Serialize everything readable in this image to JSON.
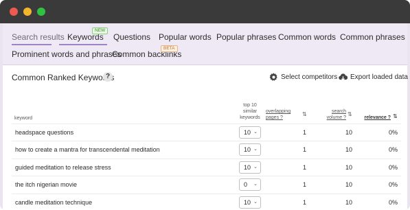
{
  "tabs": {
    "row1": [
      {
        "label": "Search results",
        "active": true
      },
      {
        "label": "Keywords",
        "badge": "NEW"
      },
      {
        "label": "Questions"
      },
      {
        "label": "Popular words"
      },
      {
        "label": "Popular phrases"
      },
      {
        "label": "Common words"
      },
      {
        "label": "Common phrases"
      }
    ],
    "row2": [
      {
        "label": "Prominent words and phrases"
      },
      {
        "label": "Common backlinks",
        "badge": "BETA"
      }
    ]
  },
  "panel": {
    "title": "Common Ranked Keywords",
    "help": "?",
    "select_competitors": "Select competitors",
    "export": "Export loaded data"
  },
  "table": {
    "headers": {
      "keyword": "keyword",
      "top10_line1": "top 10",
      "top10_line2": "similar",
      "top10_line3": "keywords",
      "overlap_line1": "overlapping",
      "overlap_line2": "pages ?",
      "volume_line1": "search",
      "volume_line2": "volume ?",
      "relevance": "relevance ?"
    },
    "rows": [
      {
        "keyword": "headspace questions",
        "top10": "10",
        "overlap": "1",
        "volume": "10",
        "relevance": "0%"
      },
      {
        "keyword": "how to create a mantra for transcendental meditation",
        "top10": "10",
        "overlap": "1",
        "volume": "10",
        "relevance": "0%"
      },
      {
        "keyword": "guided meditation to release stress",
        "top10": "10",
        "overlap": "1",
        "volume": "10",
        "relevance": "0%"
      },
      {
        "keyword": "the itch nigerian movie",
        "top10": "0",
        "overlap": "1",
        "volume": "10",
        "relevance": "0%"
      },
      {
        "keyword": "candle meditation technique",
        "top10": "10",
        "overlap": "1",
        "volume": "10",
        "relevance": "0%"
      }
    ]
  },
  "colors": {
    "accent": "#9d84c6",
    "titlebar": "#3a3a3a"
  }
}
